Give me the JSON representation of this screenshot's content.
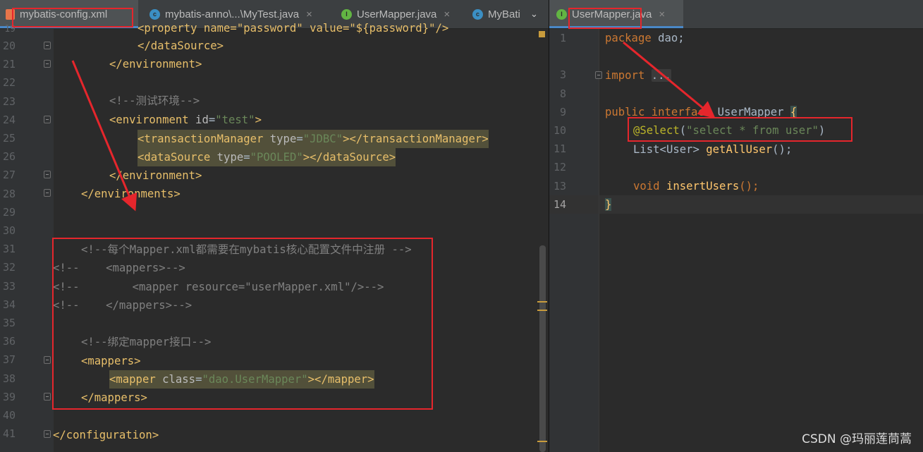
{
  "left_tabs": [
    {
      "label": "mybatis-config.xml",
      "icon": "xml-file-icon"
    },
    {
      "label": "mybatis-anno\\...\\MyTest.java",
      "icon": "class-icon"
    },
    {
      "label": "UserMapper.java",
      "icon": "interface-icon"
    },
    {
      "label": "MyBati",
      "icon": "class-icon"
    }
  ],
  "right_tabs": [
    {
      "label": "UserMapper.java",
      "icon": "interface-icon"
    }
  ],
  "left_editor": {
    "partial_top_text": "<property name=\"password\" value=\"${password}\"/>",
    "line_numbers": [
      "20",
      "21",
      "22",
      "23",
      "24",
      "25",
      "26",
      "27",
      "28",
      "29",
      "30",
      "31",
      "32",
      "33",
      "34",
      "35",
      "36",
      "37",
      "38",
      "39",
      "40",
      "41"
    ],
    "lines": {
      "l20": {
        "a": "</dataSource>"
      },
      "l21": {
        "a": "</environment>"
      },
      "l23": {
        "a": "<!--测试环境-->"
      },
      "l24": {
        "a": "<environment",
        "b": " id",
        "c": "=",
        "d": "\"test\"",
        "e": ">"
      },
      "l25": {
        "a": "<transactionManager",
        "b": " type",
        "c": "=",
        "d": "\"JDBC\"",
        "e": "></transactionManager>"
      },
      "l26": {
        "a": "<dataSource",
        "b": " type",
        "c": "=",
        "d": "\"POOLED\"",
        "e": "></dataSource>"
      },
      "l27": {
        "a": "</environment>"
      },
      "l28": {
        "a": "</environments>"
      },
      "l31": {
        "a": "<!--每个Mapper.xml都需要在mybatis核心配置文件中注册 -->"
      },
      "l32": {
        "a": "<!--    <mappers>-->"
      },
      "l33": {
        "a": "<!--        <mapper resource=\"userMapper.xml\"/>-->"
      },
      "l34": {
        "a": "<!--    </mappers>-->"
      },
      "l36": {
        "a": "<!--绑定mapper接口-->"
      },
      "l37": {
        "a": "<mappers>"
      },
      "l38": {
        "a": "<mapper",
        "b": " class",
        "c": "=",
        "d": "\"dao.UserMapper\"",
        "e": "></mapper>"
      },
      "l39": {
        "a": "</mappers>"
      },
      "l41": {
        "a": "</configuration>"
      }
    }
  },
  "right_editor": {
    "line_numbers": [
      "1",
      "3",
      "8",
      "9",
      "10",
      "11",
      "12",
      "13",
      "14"
    ],
    "lines": {
      "r1": {
        "kw": "package",
        "rest": " dao;"
      },
      "r3": {
        "kw": "import",
        "ph": "..."
      },
      "r9": {
        "kw1": "public",
        "kw2": " interface",
        "name": " UserMapper ",
        "brace": "{"
      },
      "r10": {
        "anno": "@Select",
        "p1": "(",
        "str": "\"select * from user\"",
        "p2": ")"
      },
      "r11": {
        "type": "List<User> ",
        "fn": "getAllUser",
        "rest": "();"
      },
      "r13": {
        "kw": "void",
        "sp": " ",
        "fn": "insertUsers",
        "rest": "();"
      },
      "r14": {
        "brace": "}"
      }
    }
  },
  "watermark": "CSDN @玛丽莲茼蒿",
  "colors": {
    "annotation_red": "#e5262c",
    "editor_bg": "#2b2b2b"
  }
}
